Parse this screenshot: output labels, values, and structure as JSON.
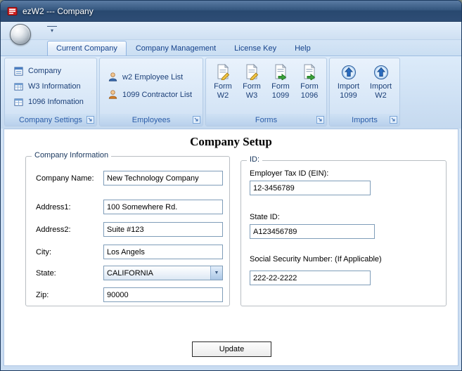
{
  "window": {
    "title": "ezW2 --- Company"
  },
  "icons": {
    "dropdown_glyph": "▾",
    "combo_arrow_glyph": "▼"
  },
  "tabs": [
    {
      "label": "Current Company"
    },
    {
      "label": "Company Management"
    },
    {
      "label": "License Key"
    },
    {
      "label": "Help"
    }
  ],
  "ribbon": {
    "groups": {
      "company_settings": {
        "caption": "Company Settings",
        "items": [
          "Company",
          "W3 Information",
          "1096 Infomation"
        ]
      },
      "employees": {
        "caption": "Employees",
        "items": [
          "w2 Employee List",
          "1099 Contractor List"
        ]
      },
      "forms": {
        "caption": "Forms",
        "items": [
          {
            "line1": "Form",
            "line2": "W2"
          },
          {
            "line1": "Form",
            "line2": "W3"
          },
          {
            "line1": "Form",
            "line2": "1099"
          },
          {
            "line1": "Form",
            "line2": "1096"
          }
        ]
      },
      "imports": {
        "caption": "Imports",
        "items": [
          {
            "line1": "Import",
            "line2": "1099"
          },
          {
            "line1": "Import",
            "line2": "W2"
          }
        ]
      }
    }
  },
  "main": {
    "heading": "Company Setup",
    "company_info": {
      "caption": "Company Information",
      "fields": {
        "company_name": {
          "label": "Company Name:",
          "value": "New Technology Company"
        },
        "address1": {
          "label": "Address1:",
          "value": "100 Somewhere Rd."
        },
        "address2": {
          "label": "Address2:",
          "value": "Suite #123"
        },
        "city": {
          "label": "City:",
          "value": "Los Angels"
        },
        "state": {
          "label": "State:",
          "value": "CALIFORNIA"
        },
        "zip": {
          "label": "Zip:",
          "value": "90000"
        }
      }
    },
    "id_info": {
      "caption": "ID:",
      "fields": {
        "ein": {
          "label": "Employer Tax ID (EIN):",
          "value": "12-3456789"
        },
        "state_id": {
          "label": "State ID:",
          "value": "A123456789"
        },
        "ssn": {
          "label": "Social Security Number: (If Applicable)",
          "value": "222-22-2222"
        }
      }
    },
    "update_button": "Update"
  }
}
